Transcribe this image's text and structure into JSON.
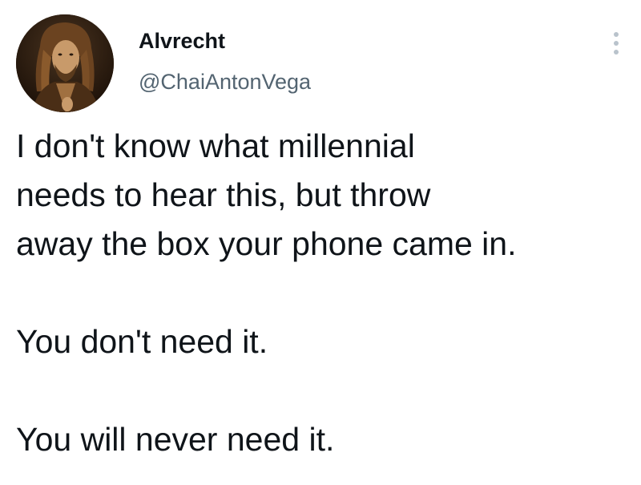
{
  "tweet": {
    "author": {
      "display_name": "Alvrecht",
      "handle": "@ChaiAntonVega",
      "avatar_icon": "portrait-avatar"
    },
    "more_icon": "more-vertical-icon",
    "text_lines": [
      "I don't know what millennial",
      "needs to hear this, but throw",
      "away the box your phone came in.",
      "You don't need it.",
      "You will never need it."
    ]
  }
}
